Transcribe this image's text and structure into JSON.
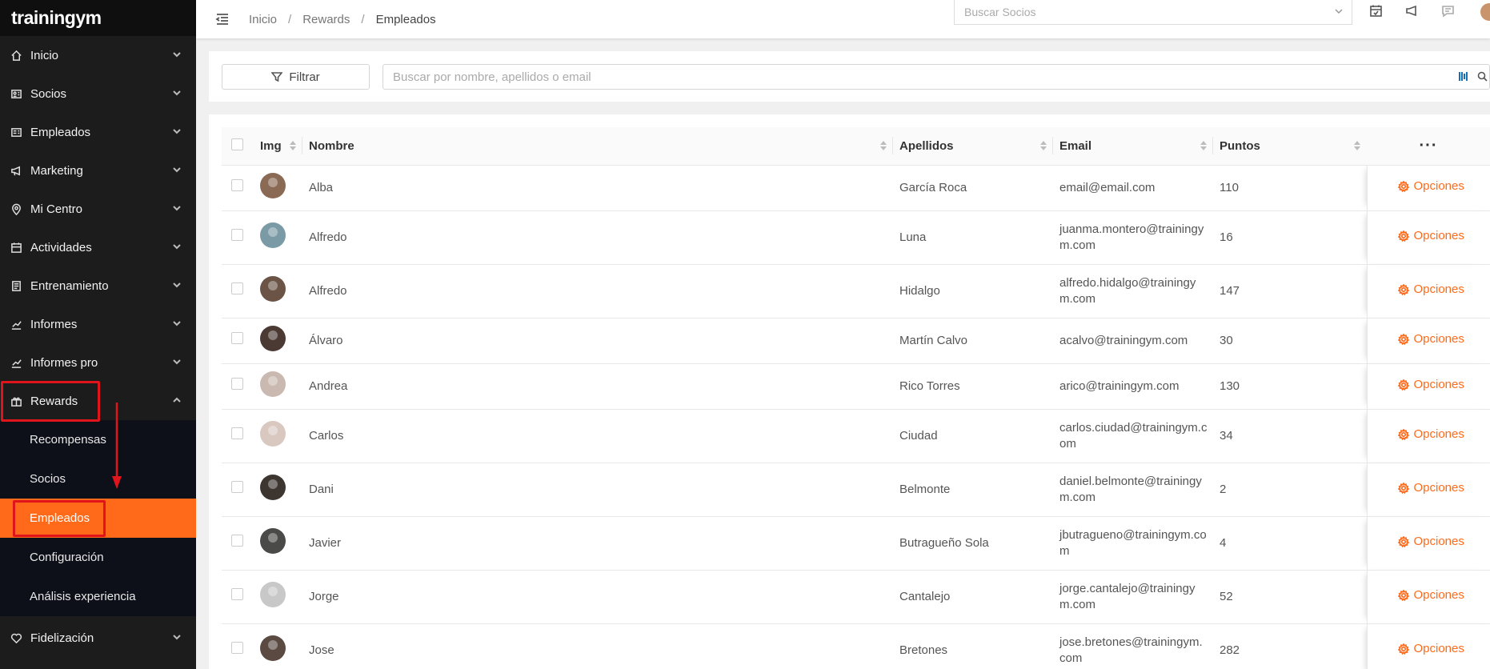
{
  "brand": {
    "logo": "trainingym"
  },
  "sidebar": {
    "items": [
      {
        "label": "Inicio",
        "icon": "home-icon"
      },
      {
        "label": "Socios",
        "icon": "id-card-icon"
      },
      {
        "label": "Empleados",
        "icon": "badge-icon"
      },
      {
        "label": "Marketing",
        "icon": "megaphone-icon"
      },
      {
        "label": "Mi Centro",
        "icon": "map-pin-icon"
      },
      {
        "label": "Actividades",
        "icon": "calendar-icon"
      },
      {
        "label": "Entrenamiento",
        "icon": "clipboard-icon"
      },
      {
        "label": "Informes",
        "icon": "chart-icon"
      },
      {
        "label": "Informes pro",
        "icon": "chart-icon"
      },
      {
        "label": "Rewards",
        "icon": "gift-icon"
      }
    ],
    "rewards_sub": [
      {
        "label": "Recompensas"
      },
      {
        "label": "Socios"
      },
      {
        "label": "Empleados"
      },
      {
        "label": "Configuración"
      },
      {
        "label": "Análisis experiencia"
      }
    ],
    "bottom_item": {
      "label": "Fidelización",
      "icon": "heart-icon"
    }
  },
  "topbar": {
    "breadcrumb": [
      "Inicio",
      "Rewards",
      "Empleados"
    ],
    "search_socios_placeholder": "Buscar Socios"
  },
  "filters": {
    "filter_label": "Filtrar",
    "search_placeholder": "Buscar por nombre, apellidos o email"
  },
  "table": {
    "headers": {
      "img": "Img",
      "nombre": "Nombre",
      "apellidos": "Apellidos",
      "email": "Email",
      "puntos": "Puntos",
      "more": "···"
    },
    "options_label": "Opciones",
    "rows": [
      {
        "nombre": "Alba",
        "apellidos": "García Roca",
        "email": "email@email.com",
        "puntos": "110",
        "avatar_color": "#8a6a55"
      },
      {
        "nombre": "Alfredo",
        "apellidos": "Luna",
        "email": "juanma.montero@trainingym.com",
        "puntos": "16",
        "avatar_color": "#7a9aa5"
      },
      {
        "nombre": "Alfredo",
        "apellidos": "Hidalgo",
        "email": "alfredo.hidalgo@trainingym.com",
        "puntos": "147",
        "avatar_color": "#6b5446"
      },
      {
        "nombre": "Álvaro",
        "apellidos": "Martín Calvo",
        "email": "acalvo@trainingym.com",
        "puntos": "30",
        "avatar_color": "#4a3a33"
      },
      {
        "nombre": "Andrea",
        "apellidos": "Rico Torres",
        "email": "arico@trainingym.com",
        "puntos": "130",
        "avatar_color": "#c9b9b0"
      },
      {
        "nombre": "Carlos",
        "apellidos": "Ciudad",
        "email": "carlos.ciudad@trainingym.com",
        "puntos": "34",
        "avatar_color": "#d9c8c0"
      },
      {
        "nombre": "Dani",
        "apellidos": "Belmonte",
        "email": "daniel.belmonte@trainingym.com",
        "puntos": "2",
        "avatar_color": "#3d3530"
      },
      {
        "nombre": "Javier",
        "apellidos": "Butragueño Sola",
        "email": "jbutragueno@trainingym.com",
        "puntos": "4",
        "avatar_color": "#4a4a48"
      },
      {
        "nombre": "Jorge",
        "apellidos": "Cantalejo",
        "email": "jorge.cantalejo@trainingym.com",
        "puntos": "52",
        "avatar_color": "#c8c8c8"
      },
      {
        "nombre": "Jose",
        "apellidos": "Bretones",
        "email": "jose.bretones@trainingym.com",
        "puntos": "282",
        "avatar_color": "#5a4a42"
      }
    ]
  },
  "colors": {
    "accent": "#ff6a1a",
    "sidebar_bg": "#1c1c1c",
    "submenu_bg": "#0e1019",
    "highlight": "#e0141b"
  }
}
